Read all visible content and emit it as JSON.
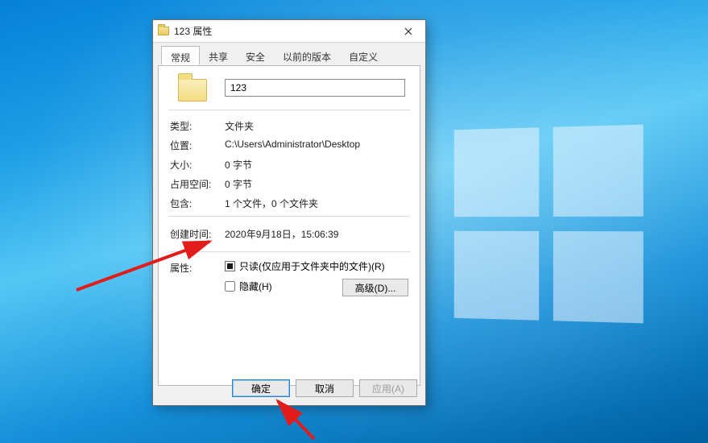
{
  "window": {
    "title": "123 属性"
  },
  "tabs": [
    "常规",
    "共享",
    "安全",
    "以前的版本",
    "自定义"
  ],
  "tabs_active_index": 0,
  "folder": {
    "name": "123"
  },
  "fields": {
    "type_label": "类型:",
    "type_value": "文件夹",
    "location_label": "位置:",
    "location_value": "C:\\Users\\Administrator\\Desktop",
    "size_label": "大小:",
    "size_value": "0 字节",
    "disk_label": "占用空间:",
    "disk_value": "0 字节",
    "contains_label": "包含:",
    "contains_value": "1 个文件，0 个文件夹",
    "created_label": "创建时间:",
    "created_value": "2020年9月18日，15:06:39",
    "attr_label": "属性:",
    "readonly_label": "只读(仅应用于文件夹中的文件)(R)",
    "hidden_label": "隐藏(H)",
    "advanced_label": "高级(D)..."
  },
  "buttons": {
    "ok": "确定",
    "cancel": "取消",
    "apply": "应用(A)"
  }
}
